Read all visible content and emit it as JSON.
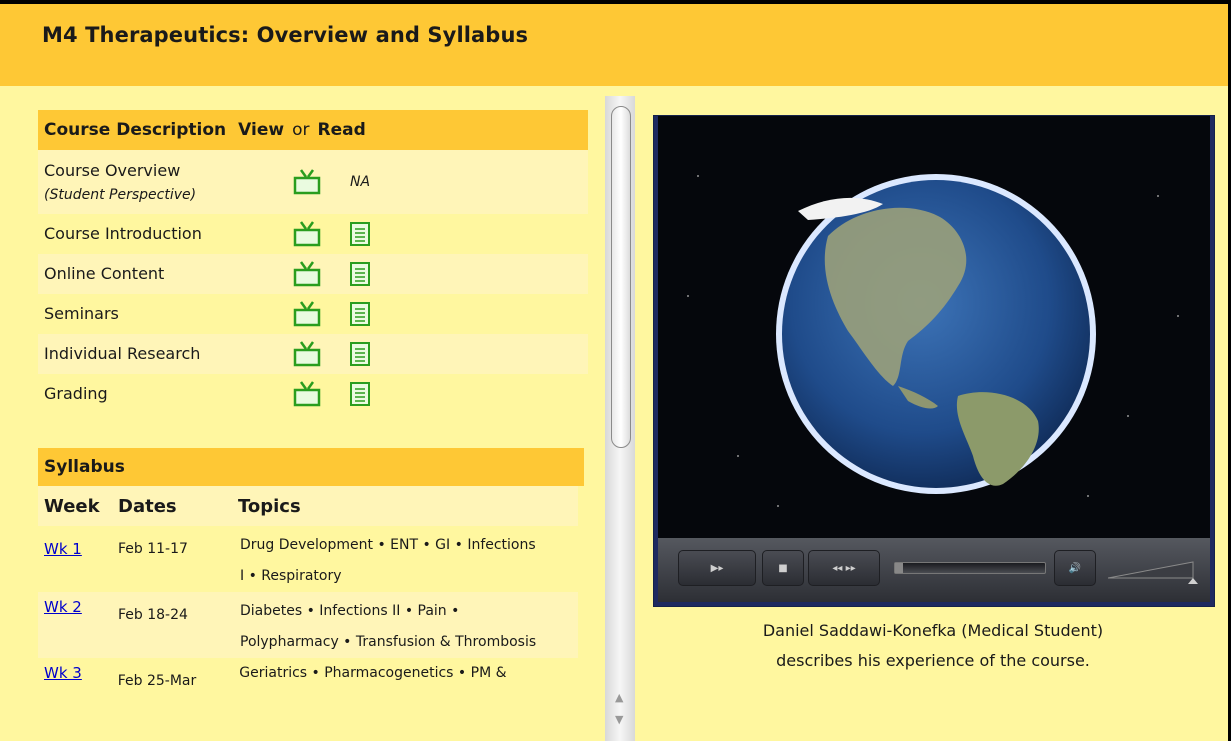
{
  "page": {
    "title": "M4 Therapeutics: Overview and Syllabus"
  },
  "course_description": {
    "heading": "Course Description",
    "view_label": "View",
    "or_label": "or",
    "read_label": "Read",
    "rows": [
      {
        "name": "Course Overview",
        "sub": "(Student Perspective)",
        "read": "NA"
      },
      {
        "name": "Course Introduction"
      },
      {
        "name": "Online Content"
      },
      {
        "name": "Seminars"
      },
      {
        "name": "Individual Research"
      },
      {
        "name": "Grading"
      }
    ]
  },
  "syllabus": {
    "heading": "Syllabus",
    "columns": [
      "Week",
      "Dates",
      "Topics"
    ],
    "rows": [
      {
        "week": "Wk 1",
        "dates": "Feb 11-17",
        "topics": "Drug Development • ENT • GI • Infections I • Respiratory"
      },
      {
        "week": "Wk 2",
        "dates": "Feb 18-24",
        "topics": "Diabetes • Infections II • Pain • Polypharmacy • Transfusion & Thrombosis"
      },
      {
        "week": "Wk 3",
        "dates": "Feb 25-Mar",
        "topics": "Geriatrics • Pharmacogenetics • PM &"
      }
    ]
  },
  "video": {
    "caption_line1": "Daniel Saddawi-Konefka (Medical Student)",
    "caption_line2": "describes his experience of the course.",
    "progress_fraction": 0.05,
    "volume_fraction": 1.0
  },
  "colors": {
    "header_bg": "#fec835",
    "page_bg": "#fff79f",
    "row_alt_bg": "#fff5b8",
    "icon_green": "#2a9d1e",
    "link_blue": "#0000cc"
  },
  "icons": {
    "view": "tv-icon",
    "read": "document-icon"
  }
}
